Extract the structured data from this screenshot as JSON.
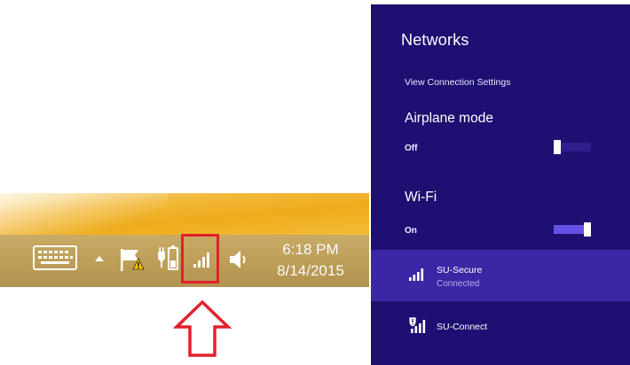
{
  "taskbar": {
    "icons": [
      {
        "name": "touch-keyboard-icon"
      },
      {
        "name": "show-hidden-icons-icon"
      },
      {
        "name": "action-center-flag-icon"
      },
      {
        "name": "power-battery-icon"
      },
      {
        "name": "network-signal-icon"
      },
      {
        "name": "volume-icon"
      }
    ],
    "clock": {
      "time": "6:18 PM",
      "date": "8/14/2015"
    }
  },
  "annotation": {
    "highlight_color": "#e3202c"
  },
  "flyout": {
    "title": "Networks",
    "view_connection_settings": "View Connection Settings",
    "airplane_mode": {
      "label": "Airplane mode",
      "state": "Off",
      "enabled": false
    },
    "wifi": {
      "label": "Wi-Fi",
      "state": "On",
      "enabled": true
    },
    "networks": [
      {
        "name": "SU-Secure",
        "status": "Connected",
        "icon": "wifi-signal-icon",
        "selected": true
      },
      {
        "name": "SU-Connect",
        "status": "",
        "icon": "wifi-open-shield-icon",
        "selected": false
      }
    ],
    "colors": {
      "background": "#1e0f72",
      "selected_row": "#3a27a6",
      "toggle_on": "#6452e6"
    }
  }
}
